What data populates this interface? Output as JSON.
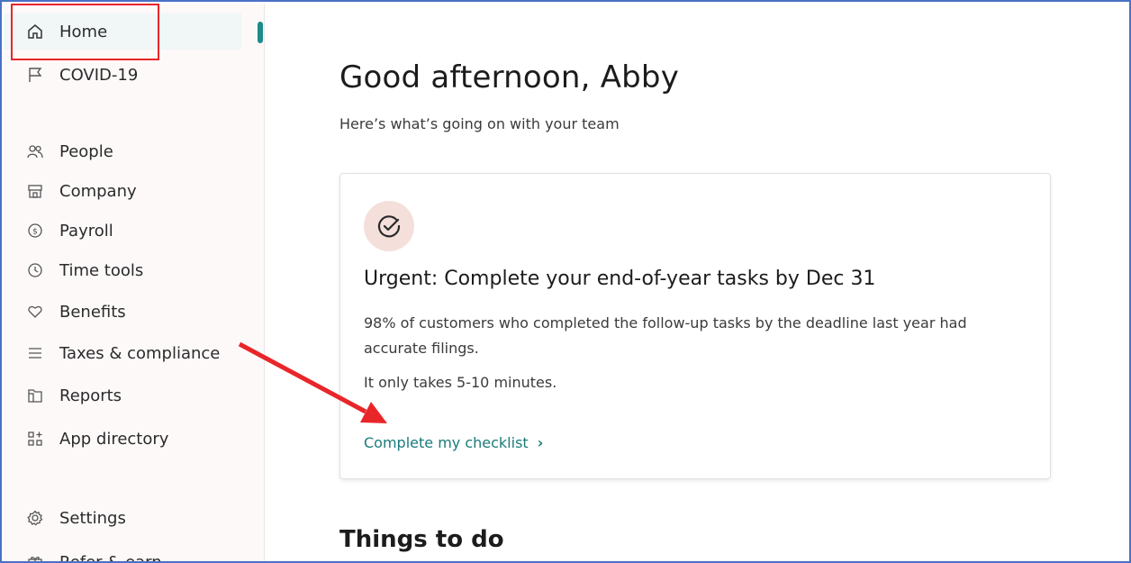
{
  "sidebar": {
    "items": [
      {
        "label": "Home",
        "icon": "home-icon"
      },
      {
        "label": "COVID-19",
        "icon": "flag-icon"
      },
      {
        "label": "People",
        "icon": "people-icon"
      },
      {
        "label": "Company",
        "icon": "storefront-icon"
      },
      {
        "label": "Payroll",
        "icon": "dollar-icon"
      },
      {
        "label": "Time tools",
        "icon": "clock-icon"
      },
      {
        "label": "Benefits",
        "icon": "heart-icon"
      },
      {
        "label": "Taxes & compliance",
        "icon": "list-icon"
      },
      {
        "label": "Reports",
        "icon": "folder-icon"
      },
      {
        "label": "App directory",
        "icon": "app-grid-icon"
      },
      {
        "label": "Settings",
        "icon": "gear-icon"
      },
      {
        "label": "Refer & earn",
        "icon": "gift-icon"
      }
    ],
    "active": "Home"
  },
  "main": {
    "greeting": "Good afternoon, Abby",
    "subtitle": "Here’s what’s going on with your team",
    "card": {
      "icon": "check-circle-icon",
      "title": "Urgent: Complete your end-of-year tasks by Dec 31",
      "text": "98% of customers who completed the follow-up tasks by the deadline last year had accurate filings.",
      "text2": "It only takes 5-10 minutes.",
      "link": "Complete my checklist",
      "link_chevron": "›"
    },
    "section_title": "Things to do"
  },
  "colors": {
    "accent": "#1a7b7b",
    "highlight": "#e8262a",
    "icon_bg": "#f4dfdb"
  }
}
